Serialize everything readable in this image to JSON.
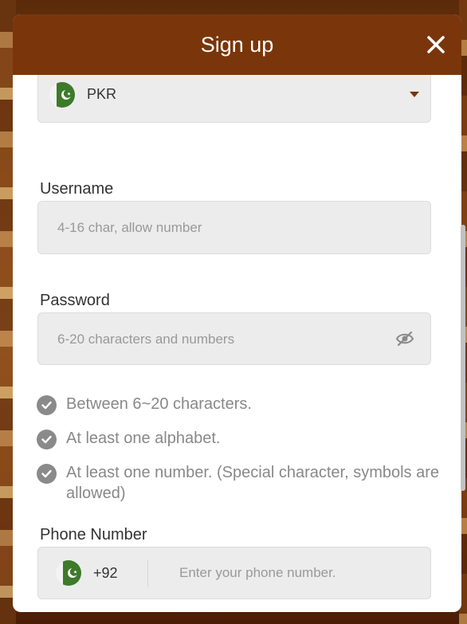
{
  "header": {
    "title": "Sign up"
  },
  "currency": {
    "code": "PKR"
  },
  "username": {
    "label": "Username",
    "placeholder": "4-16 char, allow number"
  },
  "password": {
    "label": "Password",
    "placeholder": "6-20 characters and numbers"
  },
  "rules": [
    "Between 6~20 characters.",
    "At least one alphabet.",
    "At least one number. (Special character, symbols are allowed)"
  ],
  "phone": {
    "label": "Phone Number",
    "country_code": "+92",
    "placeholder": "Enter your phone number."
  },
  "colors": {
    "header": "#7a360a",
    "field_bg": "#ececec",
    "check": "#8a8a8a",
    "flag_green": "#01411c"
  },
  "icons": {
    "close": "close-icon",
    "flag": "pakistan-flag-icon",
    "caret": "caret-down-icon",
    "eye": "eye-off-icon",
    "check": "check-circle-icon"
  }
}
